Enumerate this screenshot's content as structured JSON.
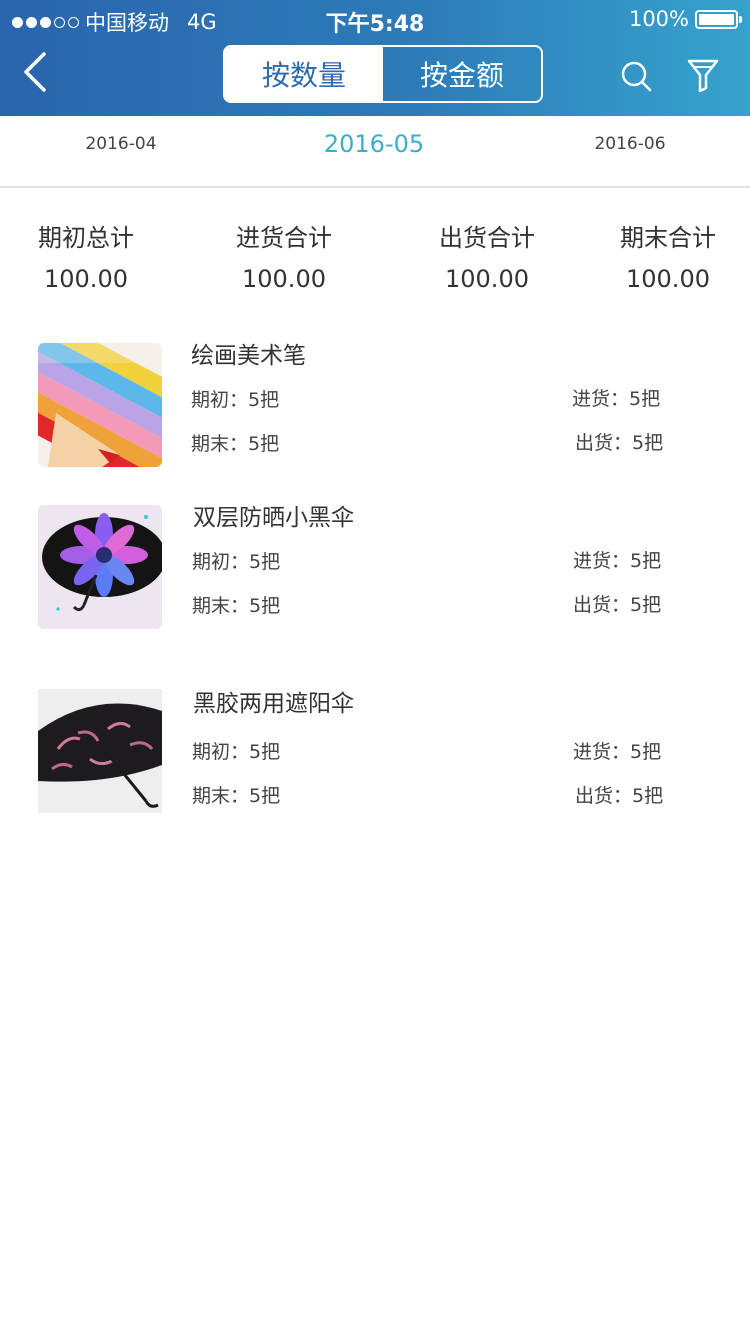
{
  "status_bar": {
    "carrier": "中国移动",
    "network": "4G",
    "time": "下午5:48",
    "battery": "100%",
    "signal_filled": 3,
    "signal_total": 5,
    "battery_level": 1.0
  },
  "nav": {
    "back_icon": "chevron-left-icon",
    "segments": [
      {
        "label": "按数量",
        "selected": true
      },
      {
        "label": "按金额",
        "selected": false
      }
    ],
    "search_icon": "search-icon",
    "filter_icon": "filter-icon"
  },
  "months": {
    "prev": "2016-04",
    "current": "2016-05",
    "next": "2016-06"
  },
  "summary": [
    {
      "label": "期初总计",
      "value": "100.00"
    },
    {
      "label": "进货合计",
      "value": "100.00"
    },
    {
      "label": "出货合计",
      "value": "100.00"
    },
    {
      "label": "期末合计",
      "value": "100.00"
    }
  ],
  "products": [
    {
      "name": "绘画美术笔",
      "opening": "期初：5把",
      "incoming": "进货：5把",
      "closing": "期末：5把",
      "outgoing": "出货：5把",
      "image": "colored-pencils-image"
    },
    {
      "name": "双层防晒小黑伞",
      "opening": "期初：5把",
      "incoming": "进货：5把",
      "closing": "期末：5把",
      "outgoing": "出货：5把",
      "image": "flower-umbrella-image"
    },
    {
      "name": "黑胶两用遮阳伞",
      "opening": "期初：5把",
      "incoming": "进货：5把",
      "closing": "期末：5把",
      "outgoing": "出货：5把",
      "image": "black-umbrella-image"
    }
  ],
  "colors": {
    "header_start": "#2a65ad",
    "header_end": "#36a3cd",
    "accent_month": "#3aaecb",
    "segment_active_text": "#2b6bb0"
  }
}
